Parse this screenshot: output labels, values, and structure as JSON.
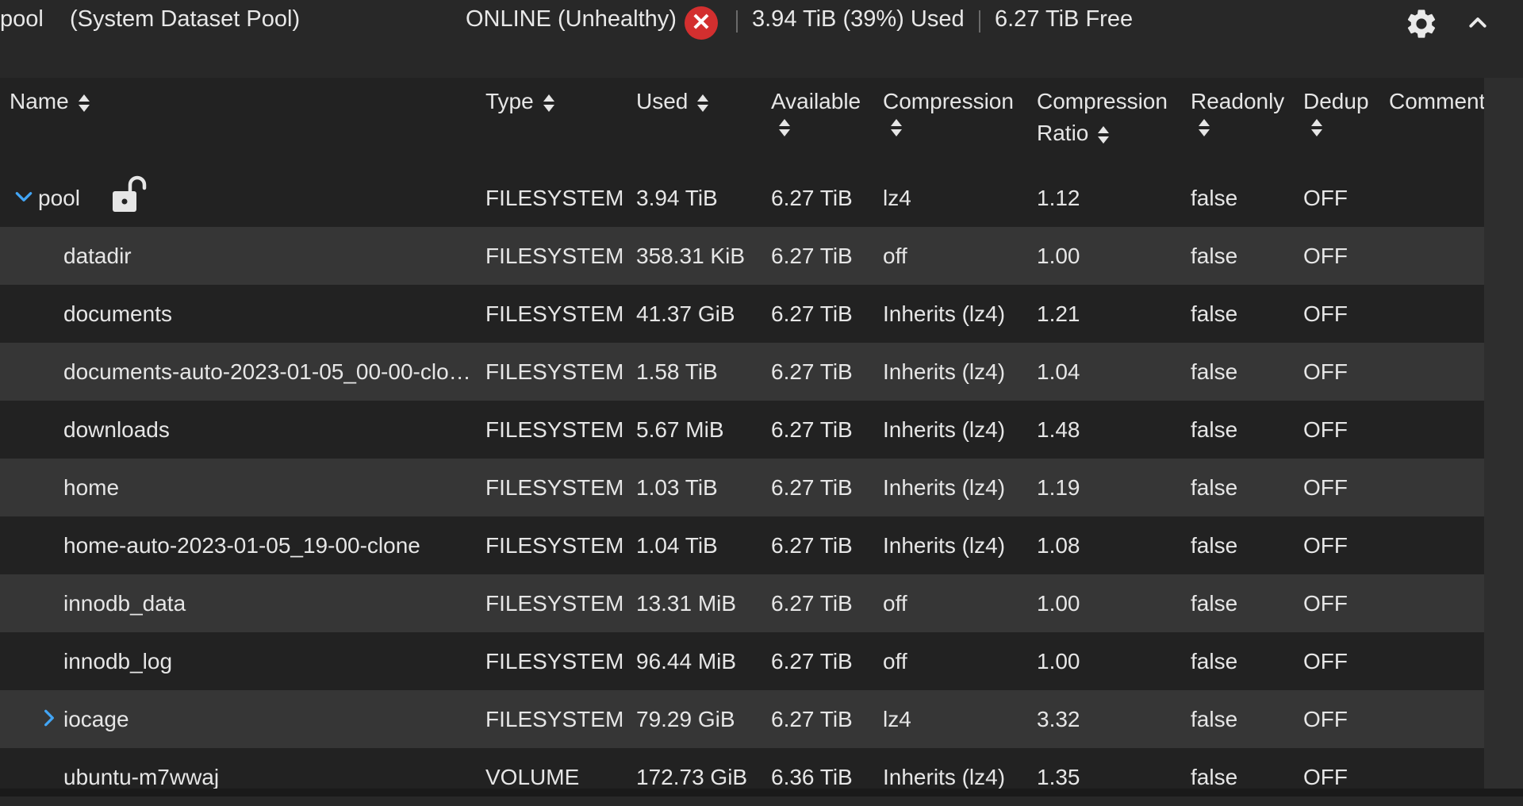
{
  "header": {
    "pool_name": "pool",
    "pool_role": "(System Dataset Pool)",
    "status": "ONLINE (Unhealthy)",
    "status_icon": "close-icon",
    "used": "3.94 TiB (39%) Used",
    "free": "6.27 TiB Free",
    "settings_icon": "gear-icon",
    "collapse_icon": "chevron-up-icon",
    "colors": {
      "status_error": "#d32f2f",
      "expander": "#42a5f5"
    }
  },
  "columns": {
    "name": "Name",
    "type": "Type",
    "used": "Used",
    "available": "Available",
    "compression": "Compression",
    "compression_ratio_1": "Compression",
    "compression_ratio_2": "Ratio",
    "readonly": "Readonly",
    "dedup": "Dedup",
    "comments": "Comment"
  },
  "rows": [
    {
      "name": "pool",
      "type": "FILESYSTEM",
      "used": "3.94 TiB",
      "available": "6.27 TiB",
      "compression": "lz4",
      "ratio": "1.12",
      "readonly": "false",
      "dedup": "OFF",
      "expander": "chevron-down-icon",
      "lock": "unlock-icon"
    },
    {
      "name": "datadir",
      "type": "FILESYSTEM",
      "used": "358.31 KiB",
      "available": "6.27 TiB",
      "compression": "off",
      "ratio": "1.00",
      "readonly": "false",
      "dedup": "OFF"
    },
    {
      "name": "documents",
      "type": "FILESYSTEM",
      "used": "41.37 GiB",
      "available": "6.27 TiB",
      "compression": "Inherits (lz4)",
      "ratio": "1.21",
      "readonly": "false",
      "dedup": "OFF"
    },
    {
      "name": "documents-auto-2023-01-05_00-00-clo…",
      "type": "FILESYSTEM",
      "used": "1.58 TiB",
      "available": "6.27 TiB",
      "compression": "Inherits (lz4)",
      "ratio": "1.04",
      "readonly": "false",
      "dedup": "OFF"
    },
    {
      "name": "downloads",
      "type": "FILESYSTEM",
      "used": "5.67 MiB",
      "available": "6.27 TiB",
      "compression": "Inherits (lz4)",
      "ratio": "1.48",
      "readonly": "false",
      "dedup": "OFF"
    },
    {
      "name": "home",
      "type": "FILESYSTEM",
      "used": "1.03 TiB",
      "available": "6.27 TiB",
      "compression": "Inherits (lz4)",
      "ratio": "1.19",
      "readonly": "false",
      "dedup": "OFF"
    },
    {
      "name": "home-auto-2023-01-05_19-00-clone",
      "type": "FILESYSTEM",
      "used": "1.04 TiB",
      "available": "6.27 TiB",
      "compression": "Inherits (lz4)",
      "ratio": "1.08",
      "readonly": "false",
      "dedup": "OFF"
    },
    {
      "name": "innodb_data",
      "type": "FILESYSTEM",
      "used": "13.31 MiB",
      "available": "6.27 TiB",
      "compression": "off",
      "ratio": "1.00",
      "readonly": "false",
      "dedup": "OFF"
    },
    {
      "name": "innodb_log",
      "type": "FILESYSTEM",
      "used": "96.44 MiB",
      "available": "6.27 TiB",
      "compression": "off",
      "ratio": "1.00",
      "readonly": "false",
      "dedup": "OFF"
    },
    {
      "name": "iocage",
      "type": "FILESYSTEM",
      "used": "79.29 GiB",
      "available": "6.27 TiB",
      "compression": "lz4",
      "ratio": "3.32",
      "readonly": "false",
      "dedup": "OFF",
      "expander": "chevron-right-icon"
    },
    {
      "name": "ubuntu-m7wwaj",
      "type": "VOLUME",
      "used": "172.73 GiB",
      "available": "6.36 TiB",
      "compression": "Inherits (lz4)",
      "ratio": "1.35",
      "readonly": "false",
      "dedup": "OFF"
    }
  ]
}
